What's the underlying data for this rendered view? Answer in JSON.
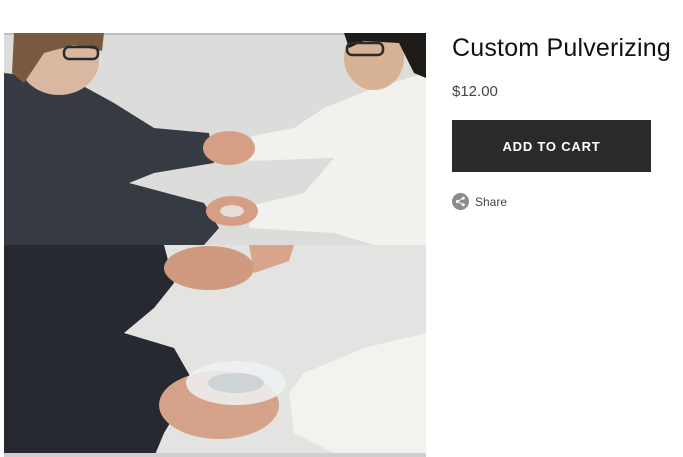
{
  "product": {
    "title": "Custom Pulverizing",
    "price": "$12.00",
    "add_to_cart_label": "ADD TO CART",
    "share_label": "Share",
    "share_icon": "share-icon"
  },
  "colors": {
    "button_bg": "#2a2a2a",
    "button_text": "#ffffff",
    "title_text": "#111111",
    "price_text": "#444444",
    "share_icon_bg": "#8c8c8c"
  }
}
